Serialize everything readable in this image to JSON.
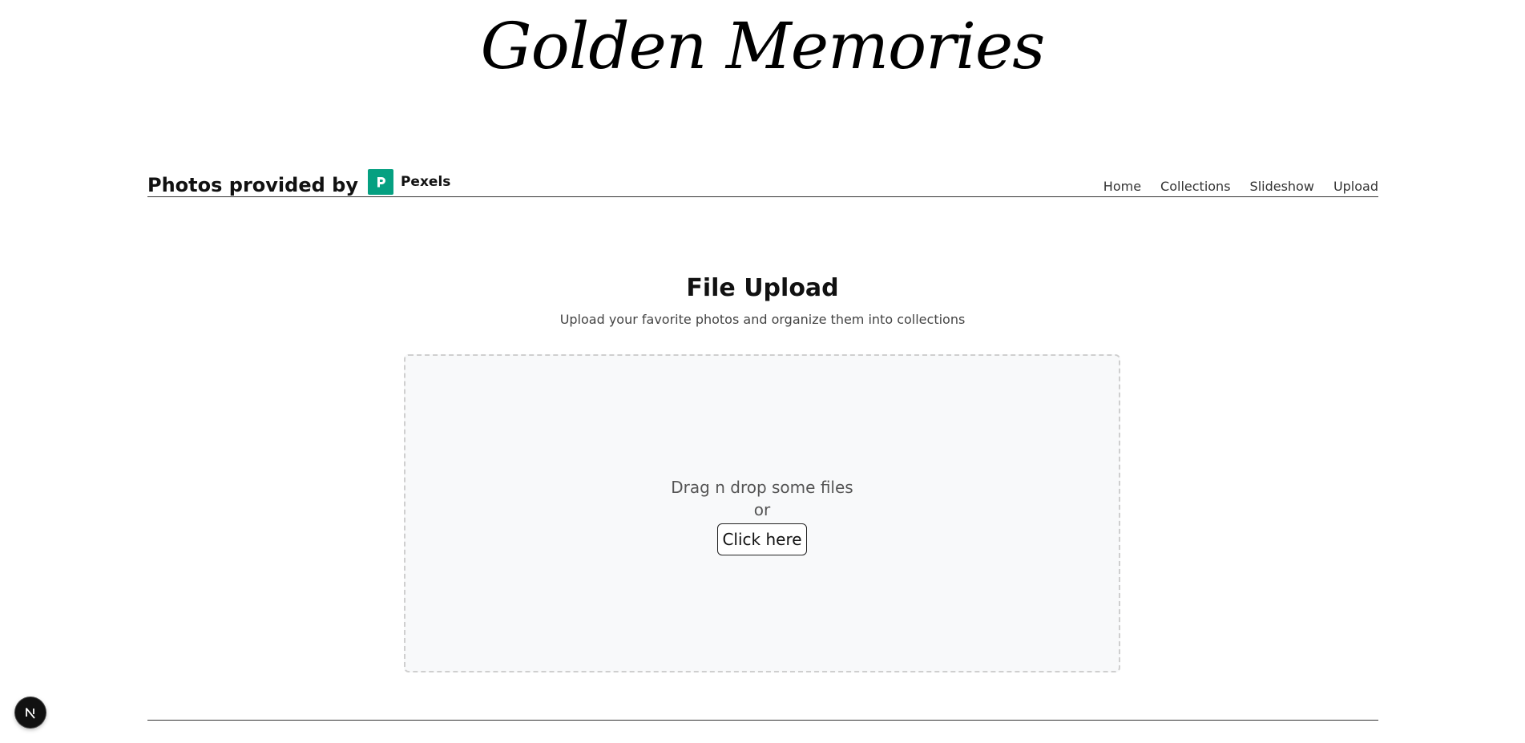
{
  "site": {
    "title": "Golden Memories"
  },
  "header": {
    "credit_text": "Photos provided by",
    "credit_brand": "Pexels",
    "nav": [
      {
        "label": "Home"
      },
      {
        "label": "Collections"
      },
      {
        "label": "Slideshow"
      },
      {
        "label": "Upload"
      }
    ]
  },
  "upload": {
    "heading": "File Upload",
    "subheading": "Upload your favorite photos and organize them into collections",
    "drop_text": "Drag n drop some files",
    "or_text": "or",
    "click_label": "Click here"
  },
  "colors": {
    "brand_green": "#05a081",
    "dropzone_bg": "#f8f9fa",
    "dropzone_border": "#cfcfcf"
  },
  "icons": {
    "pexels_logo": "pexels-logo-icon",
    "dev_badge": "nextjs-logo-icon"
  }
}
